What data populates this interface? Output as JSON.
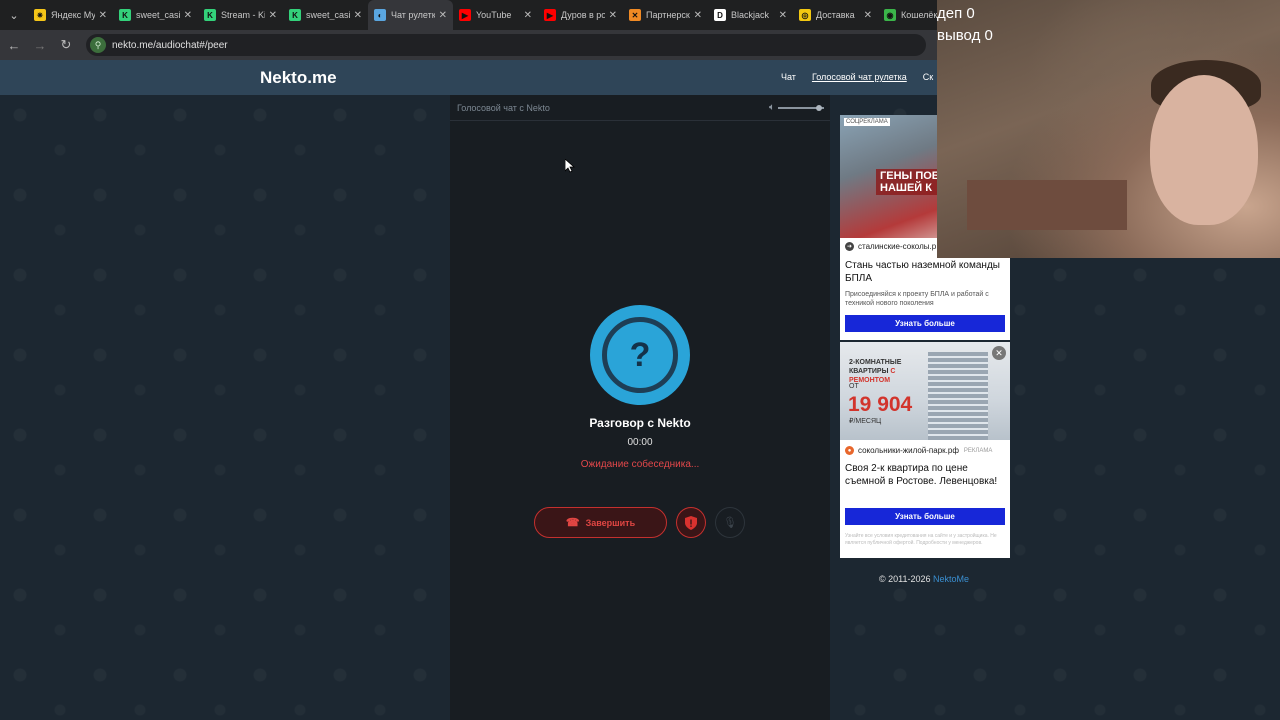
{
  "browser": {
    "tabs": [
      {
        "title": "Яндекс Музыка",
        "favicon": "star-icon",
        "color": "#f5c518",
        "active": false
      },
      {
        "title": "sweet_casino",
        "favicon": "k-icon",
        "color": "#33d17a",
        "active": false
      },
      {
        "title": "Stream - Kick",
        "favicon": "k-icon",
        "color": "#33d17a",
        "active": false
      },
      {
        "title": "sweet_casino",
        "favicon": "k-icon",
        "color": "#33d17a",
        "active": false
      },
      {
        "title": "Чат рулетка",
        "favicon": "nekto-icon",
        "color": "#5aa6e0",
        "active": true
      },
      {
        "title": "YouTube",
        "favicon": "youtube-icon",
        "color": "#ff0000",
        "active": false
      },
      {
        "title": "Дуров в роли",
        "favicon": "youtube-icon",
        "color": "#ff0000",
        "active": false
      },
      {
        "title": "Партнерская",
        "favicon": "x-icon",
        "color": "#f08a24",
        "active": false
      },
      {
        "title": "Blackjack",
        "favicon": "d-icon",
        "color": "#ffffff",
        "active": false
      },
      {
        "title": "Доставка",
        "favicon": "coin-icon",
        "color": "#f2c811",
        "active": false
      },
      {
        "title": "Кошелёк",
        "favicon": "wallet-icon",
        "color": "#3bb54a",
        "active": false
      }
    ],
    "url": "nekto.me/audiochat#/peer"
  },
  "site": {
    "logo": "Nekto.me",
    "nav": {
      "chat": "Чат",
      "voice": "Голосовой чат рулетка",
      "more": "Ск"
    }
  },
  "chat": {
    "header": "Голосовой чат с Nekto",
    "avatar_symbol": "?",
    "title": "Разговор с Nekto",
    "timer": "00:00",
    "status": "Ожидание собеседника...",
    "end_button": "Завершить",
    "volume": 0.9
  },
  "ads": {
    "ad1": {
      "tag": "СОЦРЕКЛАМА",
      "headline": "ГЕНЫ ПОБЕДЫ В НАШЕЙ К",
      "source": "сталинские-соколы.р",
      "title": "Стань частью наземной команды БПЛА",
      "desc": "Присоединяйся к проекту БПЛА и работай с техникой нового поколения",
      "button": "Узнать больше"
    },
    "ad2": {
      "line1a": "2-КОМНАТНЫЕ",
      "line1b": "КВАРТИРЫ",
      "line1c": "С РЕМОНТОМ",
      "from": "ОТ",
      "price": "19 904",
      "per": "₽/МЕСЯЦ",
      "source": "сокольники-жилой-парк.рф",
      "source_tag": "РЕКЛАМА",
      "title": "Своя 2-к квартира по цене съемной в Ростове. Левенцовка!",
      "button": "Узнать больше",
      "fine": "Узнайте все условия кредитования на сайте и у застройщика. Не является публичной офертой. Подробности у менеджеров."
    }
  },
  "footer": {
    "copyright": "© 2011-2026",
    "link": "NektoMe"
  },
  "overlay": {
    "dep": "деп 0",
    "withdraw": "вывод 0"
  }
}
